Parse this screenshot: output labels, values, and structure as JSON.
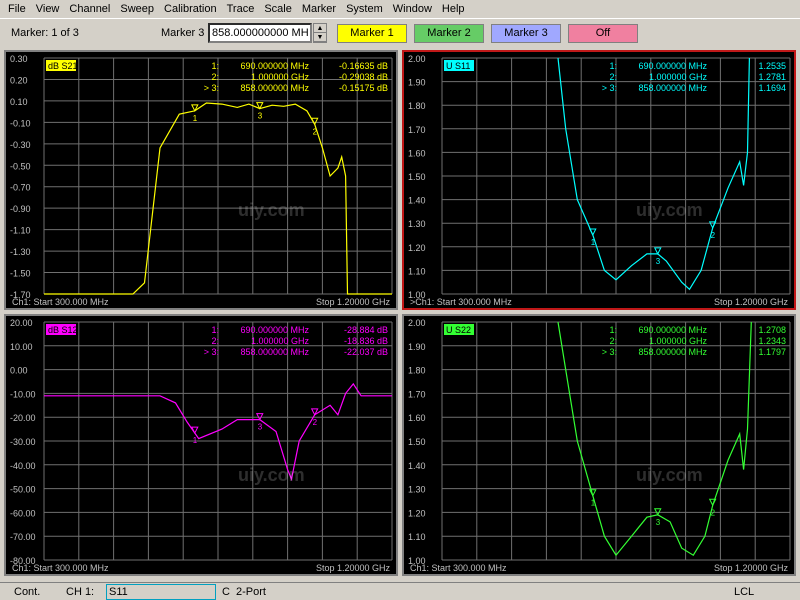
{
  "menubar": [
    "File",
    "View",
    "Channel",
    "Sweep",
    "Calibration",
    "Trace",
    "Scale",
    "Marker",
    "System",
    "Window",
    "Help"
  ],
  "toolbar": {
    "marker_of": "Marker: 1 of 3",
    "marker_label": "Marker 3",
    "marker_value": "858.000000000 MH",
    "buttons": [
      {
        "label": "Marker 1",
        "color": "#ffff00"
      },
      {
        "label": "Marker 2",
        "color": "#66cc66"
      },
      {
        "label": "Marker 3",
        "color": "#a0a8ff"
      },
      {
        "label": "Off",
        "color": "#f080a0"
      }
    ]
  },
  "panels": [
    {
      "id": "s21",
      "title": "dB S21",
      "color": "#ffff00",
      "yticks": [
        "0.30",
        "0.20",
        "0.10",
        "-0.10",
        "-0.30",
        "-0.50",
        "-0.70",
        "-0.90",
        "-1.10",
        "-1.30",
        "-1.50",
        "-1.70"
      ],
      "markers": [
        {
          "n": "1:",
          "f": "690.000000 MHz",
          "v": "-0.16635 dB"
        },
        {
          "n": "2:",
          "f": "1.000000 GHz",
          "v": "-0.29038 dB"
        },
        {
          "n": "> 3:",
          "f": "858.000000 MHz",
          "v": "-0.15175 dB"
        }
      ],
      "start": "Ch1: Start  300.000 MHz",
      "stop": "Stop  1.20000 GHz",
      "trace": [
        [
          300,
          -1.9
        ],
        [
          530,
          -1.9
        ],
        [
          560,
          -1.7
        ],
        [
          600,
          -0.5
        ],
        [
          650,
          -0.2
        ],
        [
          690,
          -0.17
        ],
        [
          720,
          -0.1
        ],
        [
          760,
          -0.11
        ],
        [
          800,
          -0.14
        ],
        [
          830,
          -0.11
        ],
        [
          858,
          -0.15
        ],
        [
          890,
          -0.12
        ],
        [
          920,
          -0.13
        ],
        [
          950,
          -0.11
        ],
        [
          980,
          -0.17
        ],
        [
          1000,
          -0.29
        ],
        [
          1020,
          -0.5
        ],
        [
          1040,
          -0.75
        ],
        [
          1060,
          -0.68
        ],
        [
          1070,
          -0.58
        ],
        [
          1080,
          -0.75
        ],
        [
          1085,
          -1.9
        ],
        [
          1200,
          -1.9
        ]
      ],
      "ylim": [
        -1.8,
        0.3
      ]
    },
    {
      "id": "s11",
      "title": "U S11",
      "color": "#00ffff",
      "yticks": [
        "2.00",
        "1.90",
        "1.80",
        "1.70",
        "1.60",
        "1.50",
        "1.40",
        "1.30",
        "1.20",
        "1.10",
        "1.00"
      ],
      "markers": [
        {
          "n": "1:",
          "f": "690.000000 MHz",
          "v": "1.2535"
        },
        {
          "n": "2:",
          "f": "1.000000 GHz",
          "v": "1.2781"
        },
        {
          "n": "> 3:",
          "f": "858.000000 MHz",
          "v": "1.1694"
        }
      ],
      "start": ">Ch1: Start  300.000 MHz",
      "stop": "Stop  1.20000 GHz",
      "trace": [
        [
          600,
          2.0
        ],
        [
          620,
          1.7
        ],
        [
          650,
          1.4
        ],
        [
          690,
          1.25
        ],
        [
          720,
          1.1
        ],
        [
          750,
          1.06
        ],
        [
          790,
          1.12
        ],
        [
          830,
          1.17
        ],
        [
          858,
          1.17
        ],
        [
          880,
          1.14
        ],
        [
          920,
          1.05
        ],
        [
          940,
          1.02
        ],
        [
          970,
          1.1
        ],
        [
          1000,
          1.28
        ],
        [
          1040,
          1.45
        ],
        [
          1070,
          1.56
        ],
        [
          1080,
          1.46
        ],
        [
          1090,
          1.6
        ],
        [
          1095,
          2.0
        ]
      ],
      "ylim": [
        1.0,
        2.0
      ]
    },
    {
      "id": "s12",
      "title": "dB S12",
      "color": "#ff00ff",
      "yticks": [
        "20.00",
        "10.00",
        "0.00",
        "-10.00",
        "-20.00",
        "-30.00",
        "-40.00",
        "-50.00",
        "-60.00",
        "-70.00",
        "-80.00"
      ],
      "markers": [
        {
          "n": "1:",
          "f": "690.000000 MHz",
          "v": "-28.884 dB"
        },
        {
          "n": "2:",
          "f": "1.000000 GHz",
          "v": "-18.836 dB"
        },
        {
          "n": "> 3:",
          "f": "858.000000 MHz",
          "v": "-22.037 dB"
        }
      ],
      "start": "Ch1: Start  300.000 MHz",
      "stop": "Stop  1.20000 GHz",
      "trace": [
        [
          300,
          -11
        ],
        [
          600,
          -11
        ],
        [
          640,
          -14
        ],
        [
          670,
          -22
        ],
        [
          700,
          -29
        ],
        [
          760,
          -25
        ],
        [
          800,
          -21
        ],
        [
          858,
          -21
        ],
        [
          900,
          -26
        ],
        [
          930,
          -42
        ],
        [
          940,
          -46
        ],
        [
          960,
          -30
        ],
        [
          1000,
          -19
        ],
        [
          1040,
          -15
        ],
        [
          1060,
          -19
        ],
        [
          1080,
          -10
        ],
        [
          1100,
          -6
        ],
        [
          1120,
          -11
        ],
        [
          1200,
          -11
        ]
      ],
      "ylim": [
        -80,
        20
      ]
    },
    {
      "id": "s22",
      "title": "U S22",
      "color": "#33ff33",
      "yticks": [
        "2.00",
        "1.90",
        "1.80",
        "1.70",
        "1.60",
        "1.50",
        "1.40",
        "1.30",
        "1.20",
        "1.10",
        "1.00"
      ],
      "markers": [
        {
          "n": "1:",
          "f": "690.000000 MHz",
          "v": "1.2708"
        },
        {
          "n": "2:",
          "f": "1.000000 GHz",
          "v": "1.2343"
        },
        {
          "n": "> 3:",
          "f": "858.000000 MHz",
          "v": "1.1797"
        }
      ],
      "start": "Ch1: Start  300.000 MHz",
      "stop": "Stop  1.20000 GHz",
      "trace": [
        [
          600,
          2.0
        ],
        [
          620,
          1.8
        ],
        [
          650,
          1.5
        ],
        [
          690,
          1.27
        ],
        [
          720,
          1.1
        ],
        [
          750,
          1.02
        ],
        [
          790,
          1.1
        ],
        [
          830,
          1.18
        ],
        [
          858,
          1.19
        ],
        [
          890,
          1.16
        ],
        [
          920,
          1.05
        ],
        [
          950,
          1.02
        ],
        [
          980,
          1.1
        ],
        [
          1000,
          1.23
        ],
        [
          1040,
          1.42
        ],
        [
          1070,
          1.53
        ],
        [
          1080,
          1.38
        ],
        [
          1090,
          1.55
        ],
        [
          1100,
          2.0
        ]
      ],
      "ylim": [
        1.0,
        2.0
      ]
    }
  ],
  "statusbar": {
    "mode": "Cont.",
    "channel": "CH 1:",
    "param": "S11",
    "cal": "C",
    "port": "2-Port",
    "lcl": "LCL"
  },
  "watermark": "uiy.com"
}
